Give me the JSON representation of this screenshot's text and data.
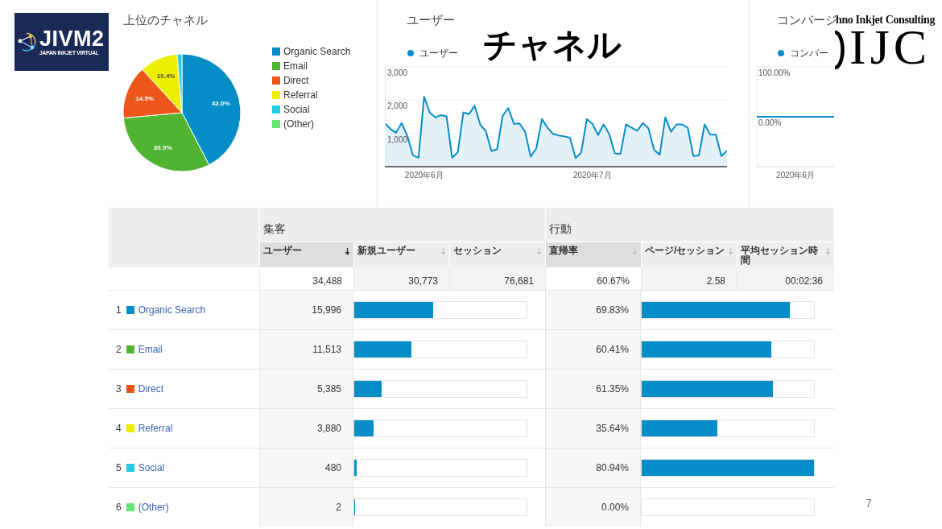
{
  "logo_left": {
    "title": "JIVM2",
    "subtitle": "JAPAN INKJET VIRTUAL"
  },
  "pie_panel": {
    "title": "上位のチャネル",
    "chart_data": {
      "type": "pie",
      "categories": [
        "Organic Search",
        "Email",
        "Direct",
        "Referral",
        "Social",
        "(Other)"
      ],
      "values": [
        42.0,
        30.9,
        14.5,
        10.4,
        1.3,
        0.0
      ],
      "value_labels": [
        "42.0%",
        "30.9%",
        "14.5%",
        "10.4%",
        null,
        null
      ],
      "colors": [
        "#058dc7",
        "#50b432",
        "#ed561b",
        "#edef00",
        "#24cbe5",
        "#64e572"
      ],
      "legend": "right"
    }
  },
  "users_panel": {
    "title": "ユーザー",
    "chart_data": {
      "type": "area",
      "legend": "top",
      "categories": [
        null,
        null,
        null,
        null,
        null,
        null,
        null,
        "2020年6月",
        null,
        null,
        null,
        null,
        null,
        null,
        null,
        null,
        null,
        null,
        null,
        null,
        null,
        null,
        null,
        null,
        null,
        null,
        null,
        null,
        null,
        null,
        null,
        null,
        null,
        null,
        null,
        null,
        null,
        "2020年7月",
        null,
        null,
        null,
        null,
        null,
        null,
        null,
        null,
        null,
        null,
        null,
        null,
        null,
        null,
        null,
        null,
        null,
        null,
        null,
        null,
        null,
        null,
        null,
        null
      ],
      "series": [
        {
          "name": "ユーザー",
          "color": "#058dc7",
          "values": [
            1310,
            1130,
            1020,
            1310,
            930,
            340,
            270,
            2100,
            1630,
            1480,
            1550,
            1510,
            270,
            430,
            1630,
            1580,
            1830,
            1270,
            1070,
            470,
            520,
            1530,
            1760,
            1290,
            1300,
            1050,
            300,
            550,
            1430,
            1170,
            980,
            940,
            910,
            870,
            260,
            420,
            1430,
            1290,
            950,
            1270,
            980,
            400,
            390,
            1270,
            1170,
            1080,
            1310,
            1150,
            500,
            360,
            1480,
            1050,
            1270,
            1270,
            1170,
            320,
            340,
            1270,
            970,
            960,
            320,
            480
          ]
        }
      ],
      "ylim": [
        0,
        3000
      ],
      "yticks": [
        {
          "value": 1000,
          "label": "1,000"
        },
        {
          "value": 2000,
          "label": "2,000"
        },
        {
          "value": 3000,
          "label": "3,000"
        }
      ]
    }
  },
  "slide_title": "チャネル",
  "conversion_panel": {
    "title": "コンバージ",
    "chart_data": {
      "type": "line",
      "legend": "top",
      "categories": [
        null,
        null,
        null,
        null,
        null,
        null,
        null,
        "2020年6月",
        null,
        null,
        null,
        null,
        null,
        null,
        null
      ],
      "series": [
        {
          "name": "コンバー",
          "color": "#058dc7",
          "values": [
            0,
            0,
            0,
            0,
            0,
            0,
            0,
            0,
            0,
            0,
            0,
            0,
            0,
            0,
            0
          ]
        }
      ],
      "ylim": [
        -100,
        100
      ],
      "yticks": [
        {
          "value": 0,
          "label": "0.00%"
        },
        {
          "value": 100,
          "label": "100.00%"
        }
      ]
    }
  },
  "logo_right": {
    "tagline": "hno Inkjet Consulting",
    "letters": "IJC"
  },
  "table": {
    "groups": [
      {
        "label": "集客",
        "columns": [
          {
            "label": "ユーザー",
            "sorted": true,
            "highlighted": true,
            "total": "34,488"
          },
          {
            "label": "新規ユーザー",
            "sorted": false,
            "highlighted": false,
            "total": "30,773"
          },
          {
            "label": "セッション",
            "sorted": false,
            "highlighted": false,
            "total": "76,681"
          }
        ]
      },
      {
        "label": "行動",
        "columns": [
          {
            "label": "直帰率",
            "sorted": false,
            "highlighted": true,
            "total": "60.67%"
          },
          {
            "label": "ページ/セッション",
            "sorted": false,
            "highlighted": false,
            "total": "2.58"
          },
          {
            "label": "平均セッション時間",
            "sorted": false,
            "highlighted": false,
            "total": "00:02:36"
          }
        ]
      }
    ],
    "rows": [
      {
        "rank": "1",
        "color": "#058dc7",
        "label": "Organic Search",
        "metrics": [
          {
            "value": "15,996",
            "level": 0.46
          },
          {
            "value": "69.83%",
            "level": 0.86
          }
        ]
      },
      {
        "rank": "2",
        "color": "#50b432",
        "label": "Email",
        "metrics": [
          {
            "value": "11,513",
            "level": 0.33
          },
          {
            "value": "60.41%",
            "level": 0.75
          }
        ]
      },
      {
        "rank": "3",
        "color": "#ed561b",
        "label": "Direct",
        "metrics": [
          {
            "value": "5,385",
            "level": 0.16
          },
          {
            "value": "61.35%",
            "level": 0.76
          }
        ]
      },
      {
        "rank": "4",
        "color": "#edef00",
        "label": "Referral",
        "metrics": [
          {
            "value": "3,880",
            "level": 0.11
          },
          {
            "value": "35.64%",
            "level": 0.44
          }
        ]
      },
      {
        "rank": "5",
        "color": "#24cbe5",
        "label": "Social",
        "metrics": [
          {
            "value": "480",
            "level": 0.014
          },
          {
            "value": "80.94%",
            "level": 1.0
          }
        ]
      },
      {
        "rank": "6",
        "color": "#64e572",
        "label": "(Other)",
        "metrics": [
          {
            "value": "2",
            "level": 0.005
          },
          {
            "value": "0.00%"
          }
        ]
      }
    ]
  },
  "page_number": "7"
}
